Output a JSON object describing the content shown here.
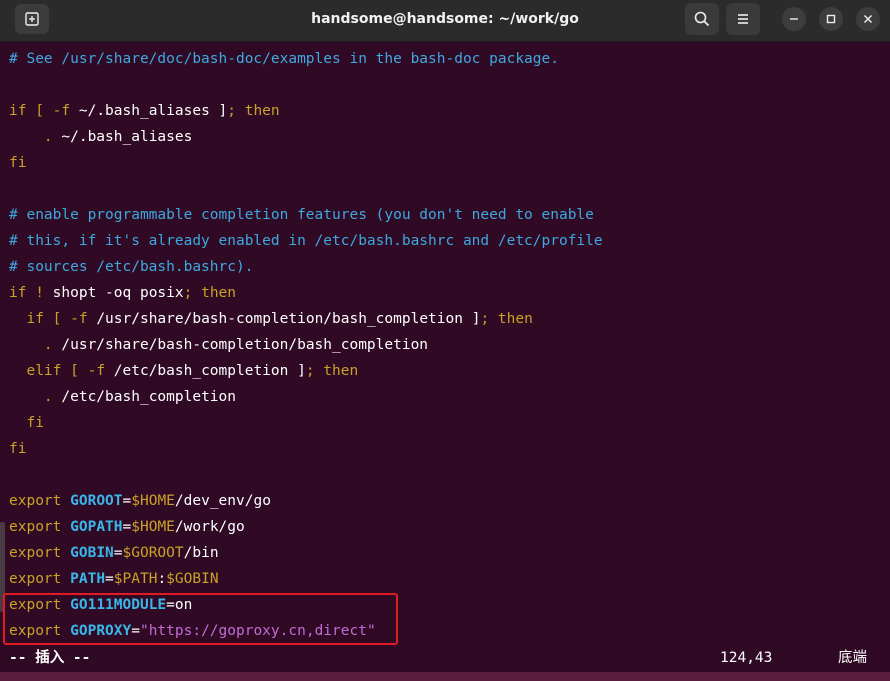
{
  "window": {
    "title": "handsome@handsome: ~/work/go",
    "buttons": {
      "new_tab_icon": "new-tab-icon",
      "search_icon": "search-icon",
      "menu_icon": "hamburger-menu-icon",
      "minimize_icon": "minimize-icon",
      "maximize_icon": "maximize-icon",
      "close_icon": "close-icon"
    }
  },
  "editor": {
    "lines": [
      {
        "text": "# See /usr/share/doc/bash-doc/examples in the bash-doc package."
      },
      {
        "text": ""
      },
      {
        "text": "if [ -f ~/.bash_aliases ]; then"
      },
      {
        "text": "    . ~/.bash_aliases"
      },
      {
        "text": "fi"
      },
      {
        "text": ""
      },
      {
        "text": "# enable programmable completion features (you don't need to enable"
      },
      {
        "text": "# this, if it's already enabled in /etc/bash.bashrc and /etc/profile"
      },
      {
        "text": "# sources /etc/bash.bashrc)."
      },
      {
        "text": "if ! shopt -oq posix; then"
      },
      {
        "text": "  if [ -f /usr/share/bash-completion/bash_completion ]; then"
      },
      {
        "text": "    . /usr/share/bash-completion/bash_completion"
      },
      {
        "text": "  elif [ -f /etc/bash_completion ]; then"
      },
      {
        "text": "    . /etc/bash_completion"
      },
      {
        "text": "  fi"
      },
      {
        "text": "fi"
      },
      {
        "text": ""
      },
      {
        "text": "export GOROOT=$HOME/dev_env/go"
      },
      {
        "text": "export GOPATH=$HOME/work/go"
      },
      {
        "text": "export GOBIN=$GOROOT/bin"
      },
      {
        "text": "export PATH=$PATH:$GOBIN"
      },
      {
        "text": "export GO111MODULE=on"
      },
      {
        "text": "export GOPROXY=\"https://goproxy.cn,direct\""
      }
    ],
    "highlighted_lines": [
      21,
      22
    ]
  },
  "status": {
    "mode": "-- 插入 --",
    "cursor_position": "124,43",
    "scroll_position": "底端"
  },
  "colors": {
    "background": "#300a24",
    "comment": "#3ea8e0",
    "keyword": "#c9a227",
    "variable": "#3ab6e8",
    "string": "#c06bd6",
    "highlight_border": "#e01b24"
  }
}
